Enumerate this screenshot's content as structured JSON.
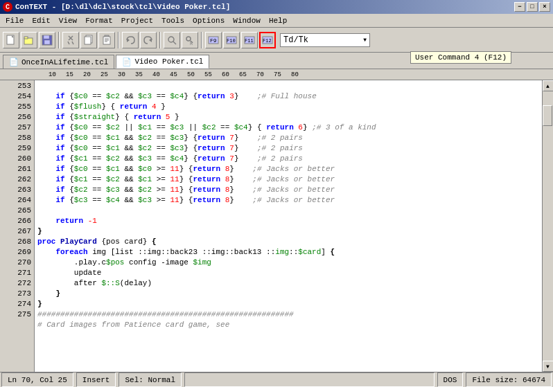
{
  "window": {
    "title": "ConTEXT - [D:\\dl\\dcl\\stock\\tcl\\Video Poker.tcl]",
    "title_icon": "C",
    "btn_minimize": "−",
    "btn_restore": "□",
    "btn_close": "×",
    "btn_min2": "−",
    "btn_rest2": "□",
    "btn_cls2": "×"
  },
  "menu": {
    "items": [
      "File",
      "Edit",
      "View",
      "Format",
      "Project",
      "Tools",
      "Options",
      "Window",
      "Help"
    ]
  },
  "toolbar": {
    "combo_value": "Td/Tk",
    "combo_arrow": "▼"
  },
  "tooltip": {
    "text": "User Command 4 (F12)"
  },
  "tabs": [
    {
      "label": "OnceInALifetime.tcl",
      "active": false
    },
    {
      "label": "Video Poker.tcl",
      "active": true
    }
  ],
  "ruler": {
    "marks": [
      "10",
      "15",
      "20",
      "25",
      "30",
      "35",
      "40",
      "45",
      "50",
      "55",
      "60",
      "65",
      "70",
      "75",
      "80"
    ]
  },
  "lines": [
    {
      "num": "253",
      "code": "    if {$c0 == $c2 && $c3 == $c4} {return 3}    ;# Full house"
    },
    {
      "num": "254",
      "code": "    if {$flush} { return 4 }"
    },
    {
      "num": "255",
      "code": "    if {$straight} { return 5 }"
    },
    {
      "num": "256",
      "code": "    if {$c0 == $c2 || $c1 == $c3 || $c2 == $c4} { return 6} ;#3 of a kind"
    },
    {
      "num": "257",
      "code": "    if {$c0 == $c1 && $c2 == $c3} {return 7}    ;# 2 pairs"
    },
    {
      "num": "258",
      "code": "    if {$c0 == $c1 && $c2 == $c3} {return 7}    ;# 2 pairs"
    },
    {
      "num": "259",
      "code": "    if {$c1 == $c2 && $c3 == $c4} {return 7}    ;# 2 pairs"
    },
    {
      "num": "260",
      "code": "    if {$c0 == $c1 && $c0 >= 11} {return 8}    ;# Jacks or better"
    },
    {
      "num": "261",
      "code": "    if {$c1 == $c2 && $c1 >= 11} {return 8}    ;# Jacks or better"
    },
    {
      "num": "262",
      "code": "    if {$c2 == $c3 && $c2 >= 11} {return 8}    ;# Jacks or better"
    },
    {
      "num": "263",
      "code": "    if {$c3 == $c4 && $c3 >= 11} {return 8}    ;# Jacks or better"
    },
    {
      "num": "264",
      "code": ""
    },
    {
      "num": "265",
      "code": "    return -1"
    },
    {
      "num": "266",
      "code": "}"
    },
    {
      "num": "267",
      "code": "proc PlayCard {pos card} {"
    },
    {
      "num": "268",
      "code": "    foreach img [list ::img::back23 ::img::back13 ::img::$card] {"
    },
    {
      "num": "269",
      "code": "        .play.c$pos config -image $img"
    },
    {
      "num": "270",
      "code": "        update"
    },
    {
      "num": "271",
      "code": "        after $::S(delay)"
    },
    {
      "num": "272",
      "code": "    }"
    },
    {
      "num": "273",
      "code": "}"
    },
    {
      "num": "274",
      "code": "########################################################"
    },
    {
      "num": "275",
      "code": "# Card images from Patience card game, see"
    }
  ],
  "status": {
    "position": "Ln 70, Col 25",
    "insert": "Insert",
    "selection": "Sel: Normal",
    "format": "DOS",
    "filesize": "File size: 64674"
  }
}
